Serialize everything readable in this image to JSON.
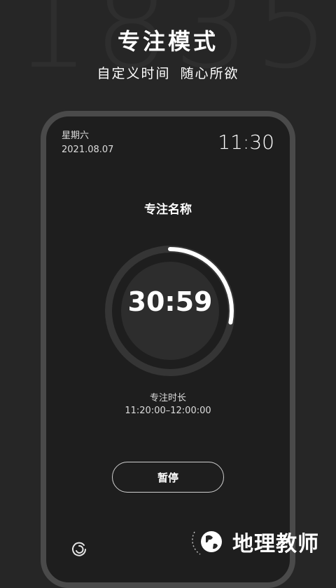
{
  "background_digits": "1835",
  "header": {
    "title": "专注模式",
    "subtitle_left": "自定义时间",
    "subtitle_right": "随心所欲"
  },
  "phone": {
    "weekday": "星期六",
    "date": "2021.08.07",
    "clock": "11:30",
    "focus_name": "专注名称",
    "countdown": "30:59",
    "progress_fraction": 0.28,
    "duration_label": "专注时长",
    "duration_range": "11:20:00–12:00:00",
    "pause_label": "暂停"
  },
  "icons": {
    "bottom_left": "refresh-icon",
    "watermark_logo": "globe-icon"
  },
  "watermark": {
    "text": "地理教师"
  },
  "colors": {
    "background": "#262626",
    "phone_bezel": "#4a4a4a",
    "ring_track": "#353535",
    "ring_progress": "#ffffff"
  }
}
